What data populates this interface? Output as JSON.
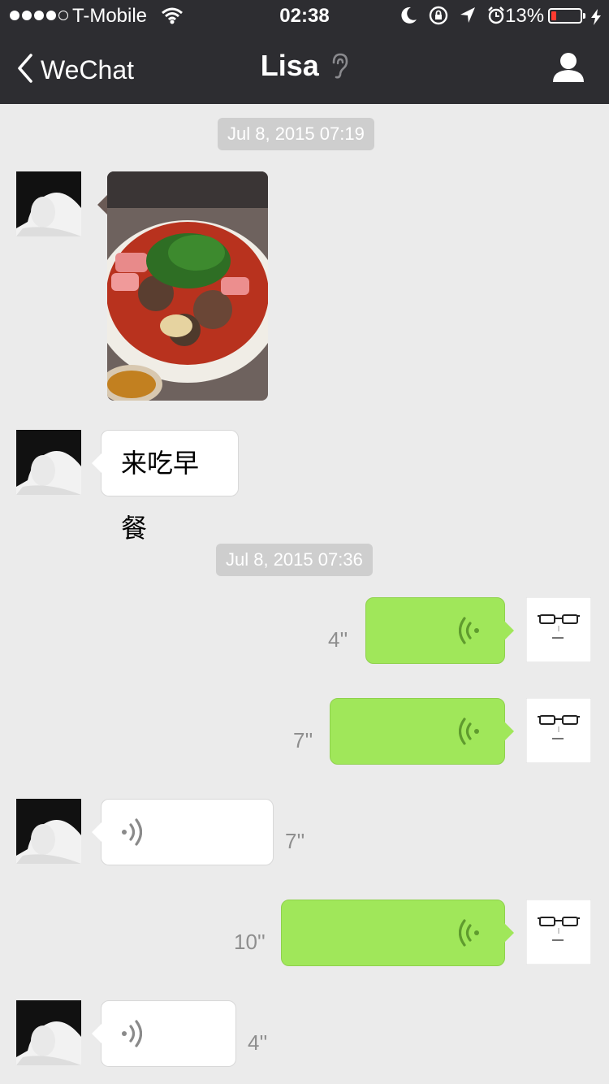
{
  "status_bar": {
    "carrier": "T-Mobile",
    "time": "02:38",
    "battery_percent": "13%",
    "icons": [
      "signal-dots",
      "wifi-icon",
      "moon-icon",
      "rotation-lock-icon",
      "location-icon",
      "alarm-icon",
      "battery-icon",
      "charging-icon"
    ]
  },
  "nav": {
    "back_label": "WeChat",
    "title": "Lisa",
    "title_icon": "ear-icon",
    "right_icon": "profile-icon"
  },
  "colors": {
    "nav_bg": "#2d2d31",
    "chat_bg": "#ebebeb",
    "outgoing_bubble": "#a0e75a",
    "incoming_bubble": "#ffffff",
    "timestamp_bg": "#cecece"
  },
  "messages": {
    "timestamp_1": "Jul 8, 2015 07:19",
    "image_msg": {
      "sender": "Lisa",
      "type": "image",
      "icon": "food-photo"
    },
    "text_msg": {
      "sender": "Lisa",
      "text": "来吃早餐"
    },
    "timestamp_2": "Jul 8, 2015 07:36",
    "voice_1": {
      "sender": "me",
      "duration": "4''"
    },
    "voice_2": {
      "sender": "me",
      "duration": "7''"
    },
    "voice_3": {
      "sender": "Lisa",
      "duration": "7''"
    },
    "voice_4": {
      "sender": "me",
      "duration": "10''"
    },
    "voice_5": {
      "sender": "Lisa",
      "duration": "4''"
    }
  }
}
